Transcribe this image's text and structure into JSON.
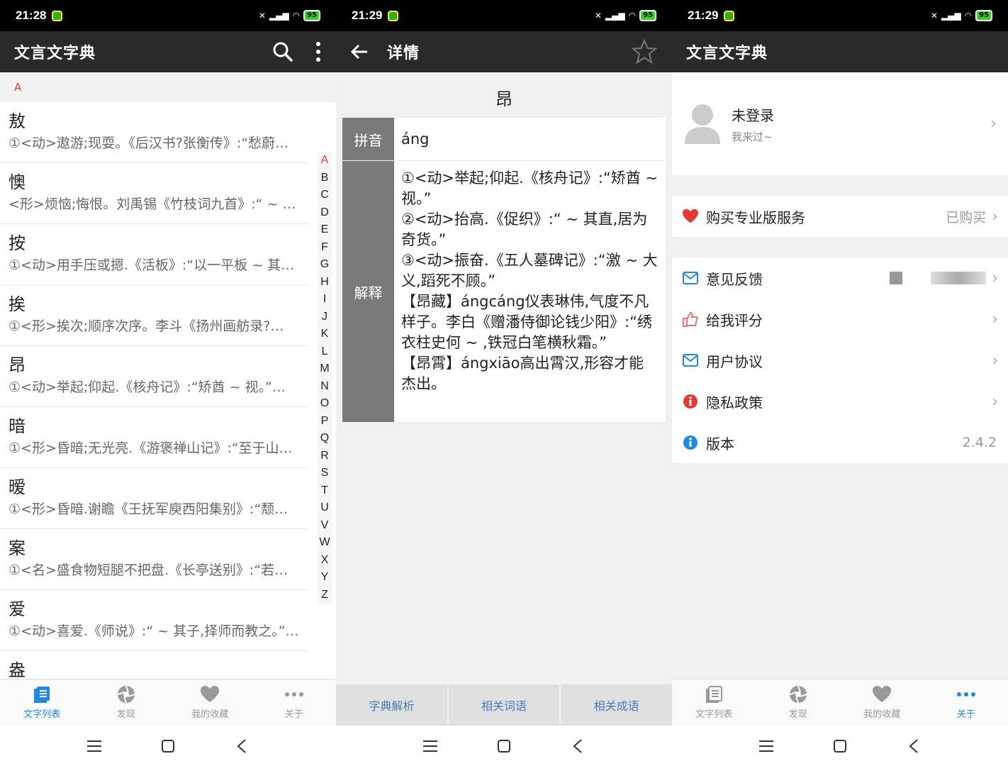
{
  "status": {
    "p1": {
      "time": "21:28"
    },
    "p2": {
      "time": "21:29"
    },
    "p3": {
      "time": "21:29"
    },
    "battery": "95"
  },
  "panel1": {
    "title": "文言文字典",
    "section": "A",
    "items": [
      {
        "char": "敖",
        "def": "①<动>遨游;现耍。《后汉书?张衡传》:“愁蔚…"
      },
      {
        "char": "懊",
        "def": "<形>烦恼;悔恨。刘禹锡《竹枝词九首》:“ ~ …"
      },
      {
        "char": "按",
        "def": "①<动>用手压或摁.《活板》:“以一平板 ~ 其…"
      },
      {
        "char": "挨",
        "def": "①<形>挨次;顺序次序。李斗《扬州画舫录?…"
      },
      {
        "char": "昂",
        "def": "①<动>举起;仰起.《核舟记》:“矫酋 ~ 视。”…"
      },
      {
        "char": "暗",
        "def": "①<形>昏暗;无光亮.《游褒禅山记》:“至于山…"
      },
      {
        "char": "暧",
        "def": "①<形>昏暗.谢瞻《王抚军庾西阳集别》:“颓…"
      },
      {
        "char": "案",
        "def": "①<名>盛食物短腿不把盘.《长亭送别》:“若…"
      },
      {
        "char": "爱",
        "def": "①<动>喜爱.《师说》:“ ~ 其子,择师而教之。”…"
      },
      {
        "char": "盎",
        "def": ""
      }
    ],
    "index": [
      "A",
      "B",
      "C",
      "D",
      "E",
      "F",
      "G",
      "H",
      "I",
      "J",
      "K",
      "L",
      "M",
      "N",
      "O",
      "P",
      "Q",
      "R",
      "S",
      "T",
      "U",
      "V",
      "W",
      "X",
      "Y",
      "Z"
    ]
  },
  "panel2": {
    "title": "详情",
    "word": "昂",
    "pinyin_label": "拼音",
    "pinyin": "áng",
    "explain_label": "解释",
    "explain": [
      "①<动>举起;仰起.《核舟记》:“矫酋 ~ 视。”",
      "②<动>抬高.《促织》:“ ~ 其直,居为奇货。”",
      "③<动>振奋.《五人墓碑记》:“激 ~ 大义,蹈死不顾。”",
      "【昂藏】ángcáng仪表琳伟,气度不凡样子。李白《赠潘侍御论钱少阳》:“绣衣柱史何 ~ ,铁冠白笔横秋霜。”",
      "【昂霄】ángxiāo高出霄汉,形容才能杰出。"
    ],
    "tabs": [
      "字典解析",
      "相关词语",
      "相关成语"
    ]
  },
  "panel3": {
    "title": "文言文字典",
    "profile_name": "未登录",
    "profile_sub": "我来过~",
    "pro_label": "购买专业版服务",
    "pro_value": "已购买",
    "feedback": "意见反馈",
    "rate": "给我评分",
    "agreement": "用户协议",
    "privacy": "隐私政策",
    "version_label": "版本",
    "version": "2.4.2"
  },
  "nav": [
    "文字列表",
    "发现",
    "我的收藏",
    "关于"
  ],
  "colors": {
    "accent": "#1e88e5",
    "red": "#e53935",
    "toolbar": "#2a2a2a"
  }
}
